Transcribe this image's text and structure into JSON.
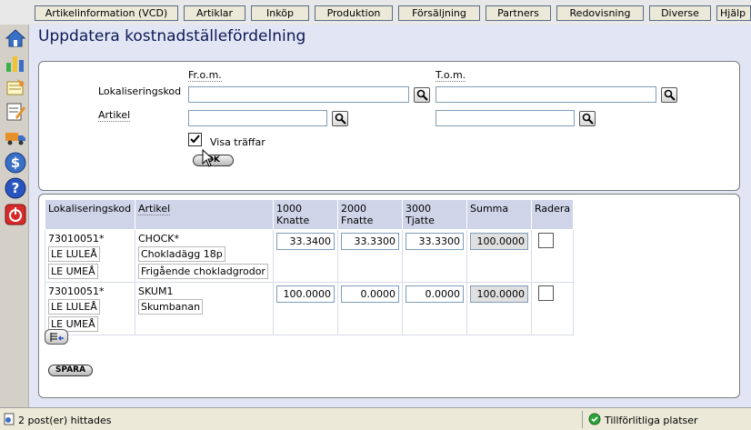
{
  "nav": {
    "tabs": [
      "Artikelinformation (VCD)",
      "Artiklar",
      "Inköp",
      "Produktion",
      "Försäljning",
      "Partners",
      "Redovisning",
      "Diverse",
      "Hjälp"
    ]
  },
  "sidebar": {
    "icons": [
      "home-icon",
      "chart-icon",
      "notes-icon",
      "edit-icon",
      "truck-icon",
      "dollar-icon",
      "help-icon",
      "power-icon"
    ]
  },
  "page": {
    "title": "Uppdatera kostnadställefördelning"
  },
  "filter": {
    "from_label": "Fr.o.m.",
    "to_label": "T.o.m.",
    "location_label": "Lokaliseringskod",
    "article_label": "Artikel",
    "location_from": "",
    "location_to": "",
    "article_from": "",
    "article_to": "",
    "show_hits_label": "Visa träffar",
    "show_hits_checked": true,
    "ok_label": "OK"
  },
  "table": {
    "headers": {
      "location": "Lokaliseringskod",
      "article": "Artikel",
      "c1_line1": "1000",
      "c1_line2": "Knatte",
      "c2_line1": "2000",
      "c2_line2": "Fnatte",
      "c3_line1": "3000",
      "c3_line2": "Tjatte",
      "sum": "Summa",
      "delete": "Radera"
    },
    "rows": [
      {
        "location": "73010051*",
        "location_subs": [
          "LE LULEÅ",
          "LE UMEÅ"
        ],
        "article": "CHOCK*",
        "article_subs": [
          "Chokladägg 18p",
          "Frigående chokladgrodor"
        ],
        "v1": "33.3400",
        "v2": "33.3300",
        "v3": "33.3300",
        "sum": "100.0000"
      },
      {
        "location": "73010051*",
        "location_subs": [
          "LE LULEÅ",
          "LE UMEÅ"
        ],
        "article": "SKUM1",
        "article_subs": [
          "Skumbanan"
        ],
        "v1": "100.0000",
        "v2": "0.0000",
        "v3": "0.0000",
        "sum": "100.0000"
      }
    ]
  },
  "save_label": "SPARA",
  "status": {
    "text": "2 post(er) hittades",
    "zone": "Tillförlitliga platser"
  }
}
